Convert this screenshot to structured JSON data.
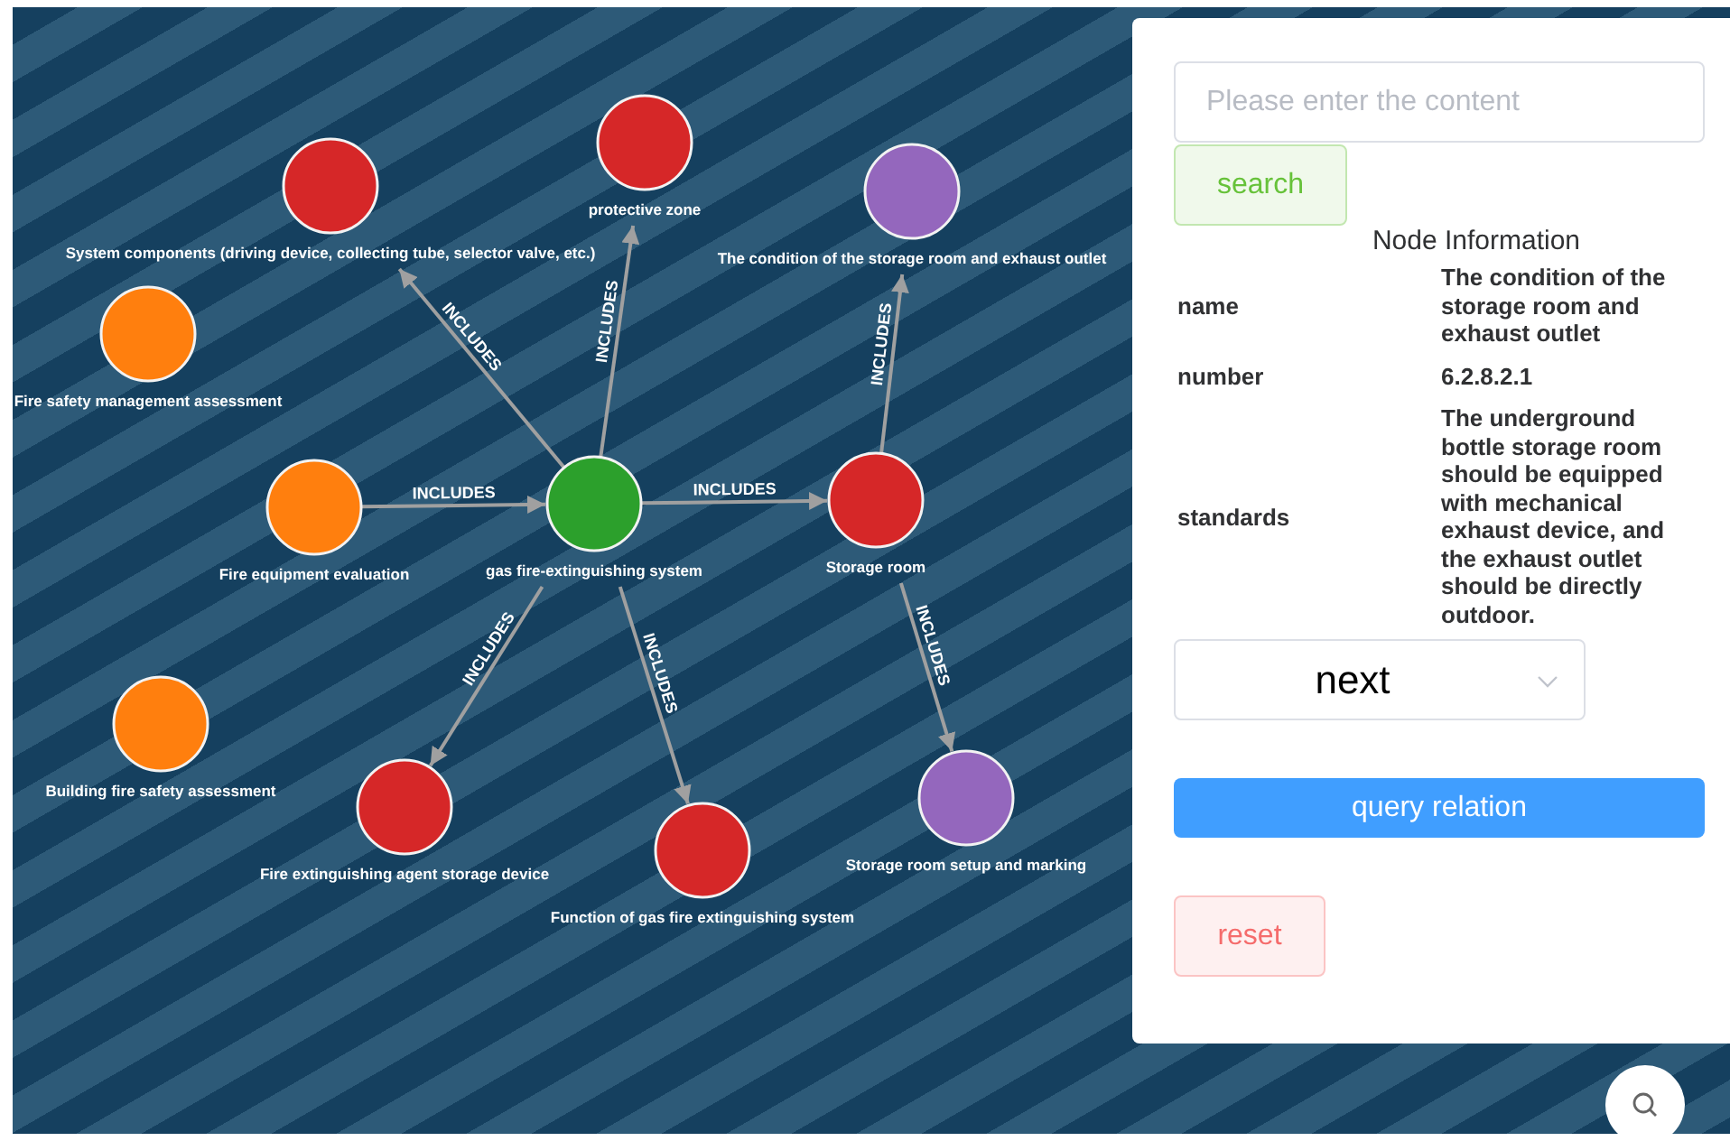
{
  "graph": {
    "nodes": [
      {
        "label": "System components (driving device, collecting tube, selector valve, etc.)",
        "color": "#d62728"
      },
      {
        "label": "protective zone",
        "color": "#d62728"
      },
      {
        "label": "The condition of the storage room and exhaust outlet",
        "color": "#9467bd"
      },
      {
        "label": "Fire safety management assessment",
        "color": "#ff7f0e"
      },
      {
        "label": "Fire equipment evaluation",
        "color": "#ff7f0e"
      },
      {
        "label": "gas fire-extinguishing system",
        "color": "#2ca02c"
      },
      {
        "label": "Storage room",
        "color": "#d62728"
      },
      {
        "label": "Building fire safety assessment",
        "color": "#ff7f0e"
      },
      {
        "label": "Fire extinguishing agent storage device",
        "color": "#d62728"
      },
      {
        "label": "Function of gas fire extinguishing system",
        "color": "#d62728"
      },
      {
        "label": "Storage room setup and marking",
        "color": "#9467bd"
      }
    ],
    "edges": [
      {
        "label": "INCLUDES"
      },
      {
        "label": "INCLUDES"
      },
      {
        "label": "INCLUDES"
      },
      {
        "label": "INCLUDES"
      },
      {
        "label": "INCLUDES"
      },
      {
        "label": "INCLUDES"
      },
      {
        "label": "INCLUDES"
      },
      {
        "label": "INCLUDES"
      }
    ]
  },
  "panel": {
    "search": {
      "placeholder": "Please enter the content"
    },
    "search_button": "search",
    "title": "Node Information",
    "info": [
      {
        "key": "name",
        "value": "The condition of the storage room and exhaust outlet"
      },
      {
        "key": "number",
        "value": "6.2.8.2.1"
      },
      {
        "key": "standards",
        "value": "The underground bottle storage room should be equipped with mechanical exhaust device, and the exhaust outlet should be directly outdoor."
      }
    ],
    "direction_select": "next",
    "query_button": "query relation",
    "reset_button": "reset"
  }
}
